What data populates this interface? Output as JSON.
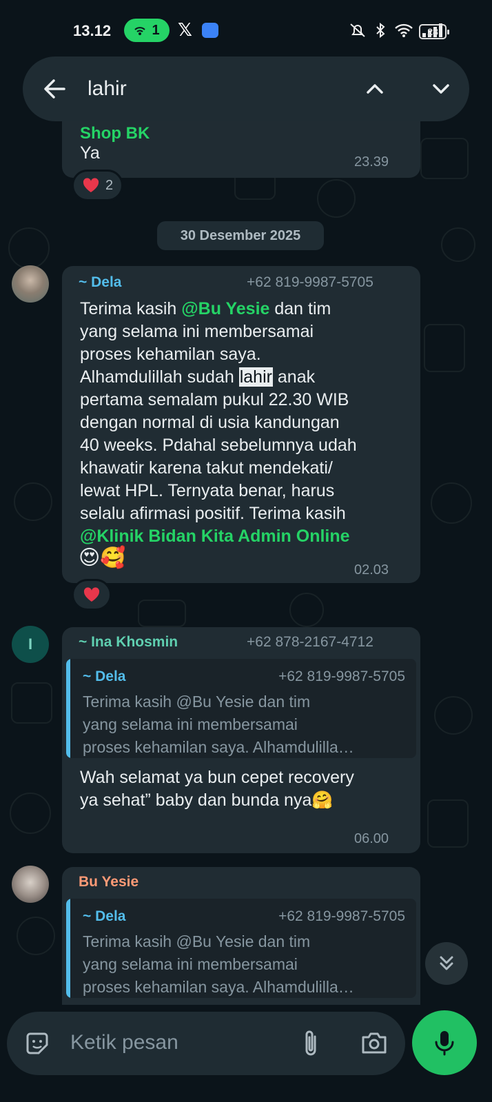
{
  "status_bar": {
    "time": "13.12",
    "hotspot_count": "1",
    "battery": "28"
  },
  "search": {
    "query": "lahir"
  },
  "messages": [
    {
      "sender": "Shop BK",
      "text": "Ya",
      "time": "23.39",
      "reaction": {
        "emoji": "heart",
        "count": "2"
      }
    },
    {
      "date_separator": "30 Desember 2025"
    },
    {
      "sender": "~ Dela",
      "phone": "+62 819-9987-5705",
      "text_a": "Terima kasih ",
      "mention_1": "@Bu Yesie",
      "text_b": " dan tim\nyang selama ini membersamai\nproses kehamilan saya.\nAlhamdulillah sudah ",
      "highlight": "lahir",
      "text_c": " anak\npertama semalam pukul 22.30 WIB\ndengan normal di usia kandungan\n40 weeks. Pdahal sebelumnya udah\nkhawatir karena takut mendekati/\nlewat HPL. Ternyata benar, harus\nselalu afirmasi positif. Terima kasih\n",
      "mention_2": "@Klinik Bidan Kita Admin Online",
      "emojis": "😍🥰",
      "time": "02.03",
      "reaction": {
        "emoji": "heart"
      }
    },
    {
      "sender": "~ Ina Khosmin",
      "avatar_letter": "I",
      "phone": "+62 878-2167-4712",
      "quote": {
        "sender": "~ Dela",
        "phone": "+62 819-9987-5705",
        "text": "Terima kasih @Bu Yesie dan tim\nyang selama ini membersamai\nproses kehamilan saya. Alhamdulilla…"
      },
      "text": "Wah selamat ya bun cepet recovery\nya sehat” baby dan bunda nya🤗",
      "time": "06.00"
    },
    {
      "sender": "Bu Yesie",
      "quote": {
        "sender": "~ Dela",
        "phone": "+62 819-9987-5705",
        "text": "Terima kasih @Bu Yesie dan tim\nyang selama ini membersamai\nproses kehamilan saya. Alhamdulilla…"
      }
    }
  ],
  "composer": {
    "placeholder": "Ketik pesan"
  },
  "colors": {
    "background": "#0b141a",
    "bubble": "#202c33",
    "accent_green": "#25d366",
    "dela_name": "#53bdeb",
    "ina_name": "#5fcfb0",
    "bu_yesie_name": "#ff9a76",
    "shop_name": "#25d366"
  },
  "icons": [
    "back-arrow-icon",
    "chevron-up-icon",
    "chevron-down-icon",
    "sticker-icon",
    "attach-icon",
    "camera-icon",
    "mic-icon",
    "scroll-down-icon",
    "heart-icon"
  ]
}
